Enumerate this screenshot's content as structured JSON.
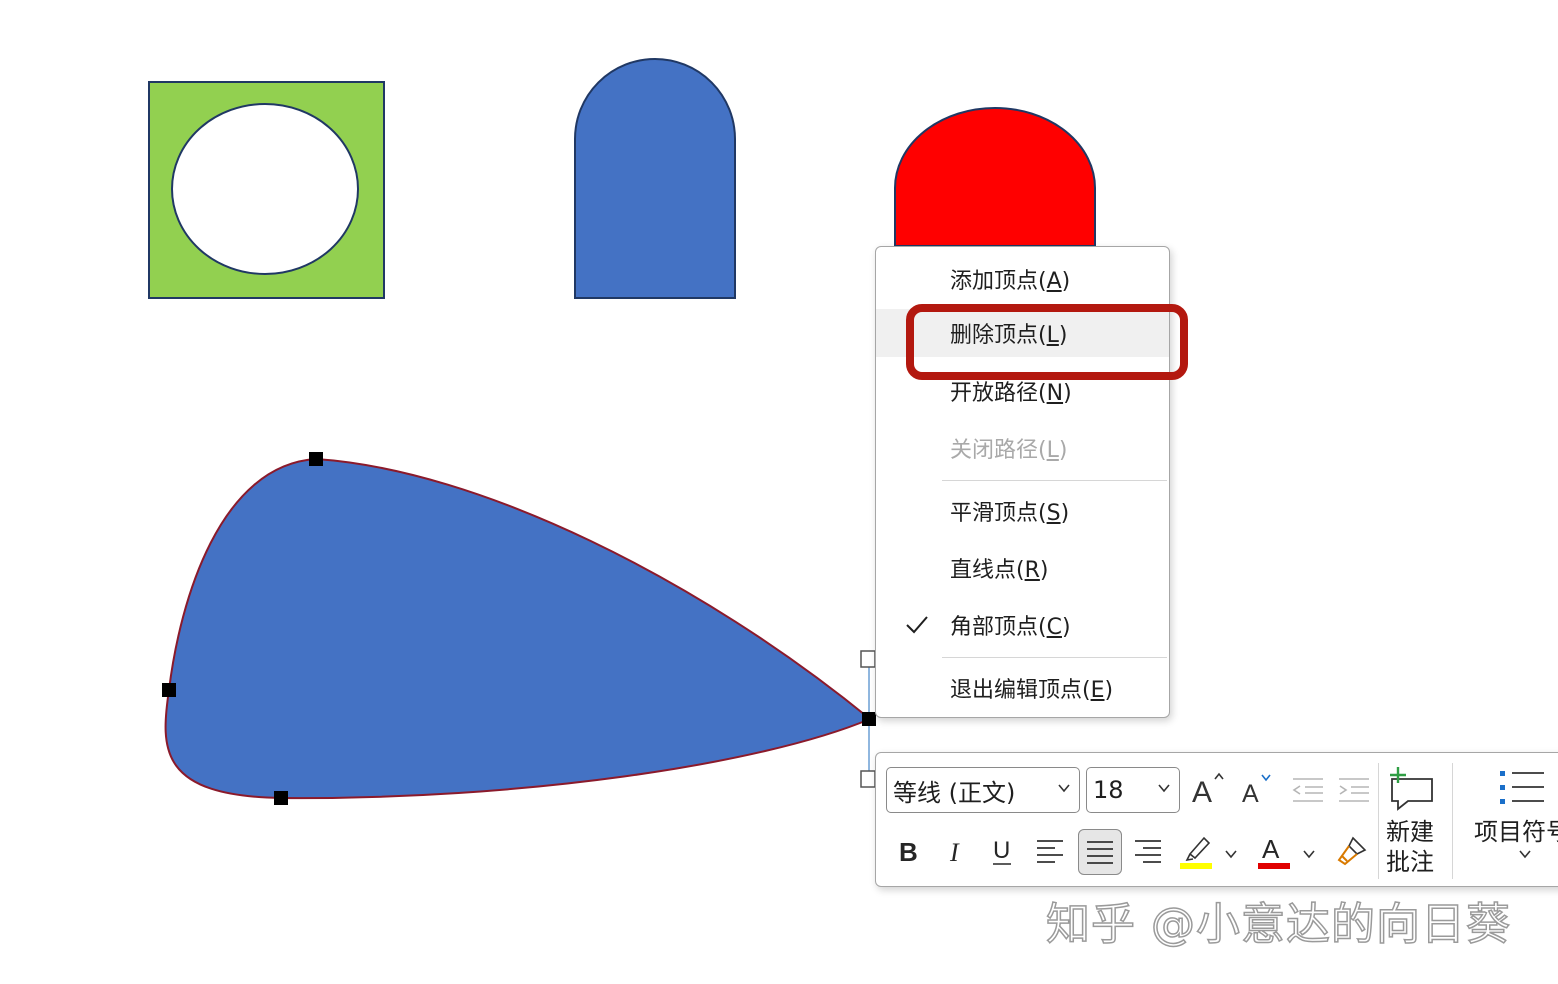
{
  "context_menu": {
    "items": [
      {
        "text": "添加顶点(",
        "key": "A",
        "end": ")"
      },
      {
        "text": "删除顶点(",
        "key": "L",
        "end": ")"
      },
      {
        "text": "开放路径(",
        "key": "N",
        "end": ")"
      },
      {
        "text": "关闭路径(",
        "key": "L",
        "end": ")"
      },
      {
        "text": "平滑顶点(",
        "key": "S",
        "end": ")"
      },
      {
        "text": "直线点(",
        "key": "R",
        "end": ")"
      },
      {
        "text": "角部顶点(",
        "key": "C",
        "end": ")"
      },
      {
        "text": "退出编辑顶点(",
        "key": "E",
        "end": ")"
      }
    ],
    "checked_item": "角部顶点(C)",
    "disabled_item": "关闭路径(L)",
    "highlighted_item": "删除顶点(L)"
  },
  "mini_toolbar": {
    "font_name": "等线 (正文)",
    "font_size": "18",
    "new_comment_line1": "新建",
    "new_comment_line2": "批注",
    "bullets_label": "项目符号",
    "highlight_color": "#ffff00",
    "font_color": "#e00000"
  },
  "shapes": {
    "green_frame_fill": "#92d050",
    "blue_fill": "#4472c4",
    "red_fill": "#ff0000",
    "outline": "#203864",
    "edit_path_outline": "#8b1a2b"
  },
  "watermark": "知乎 @小意达的向日葵"
}
